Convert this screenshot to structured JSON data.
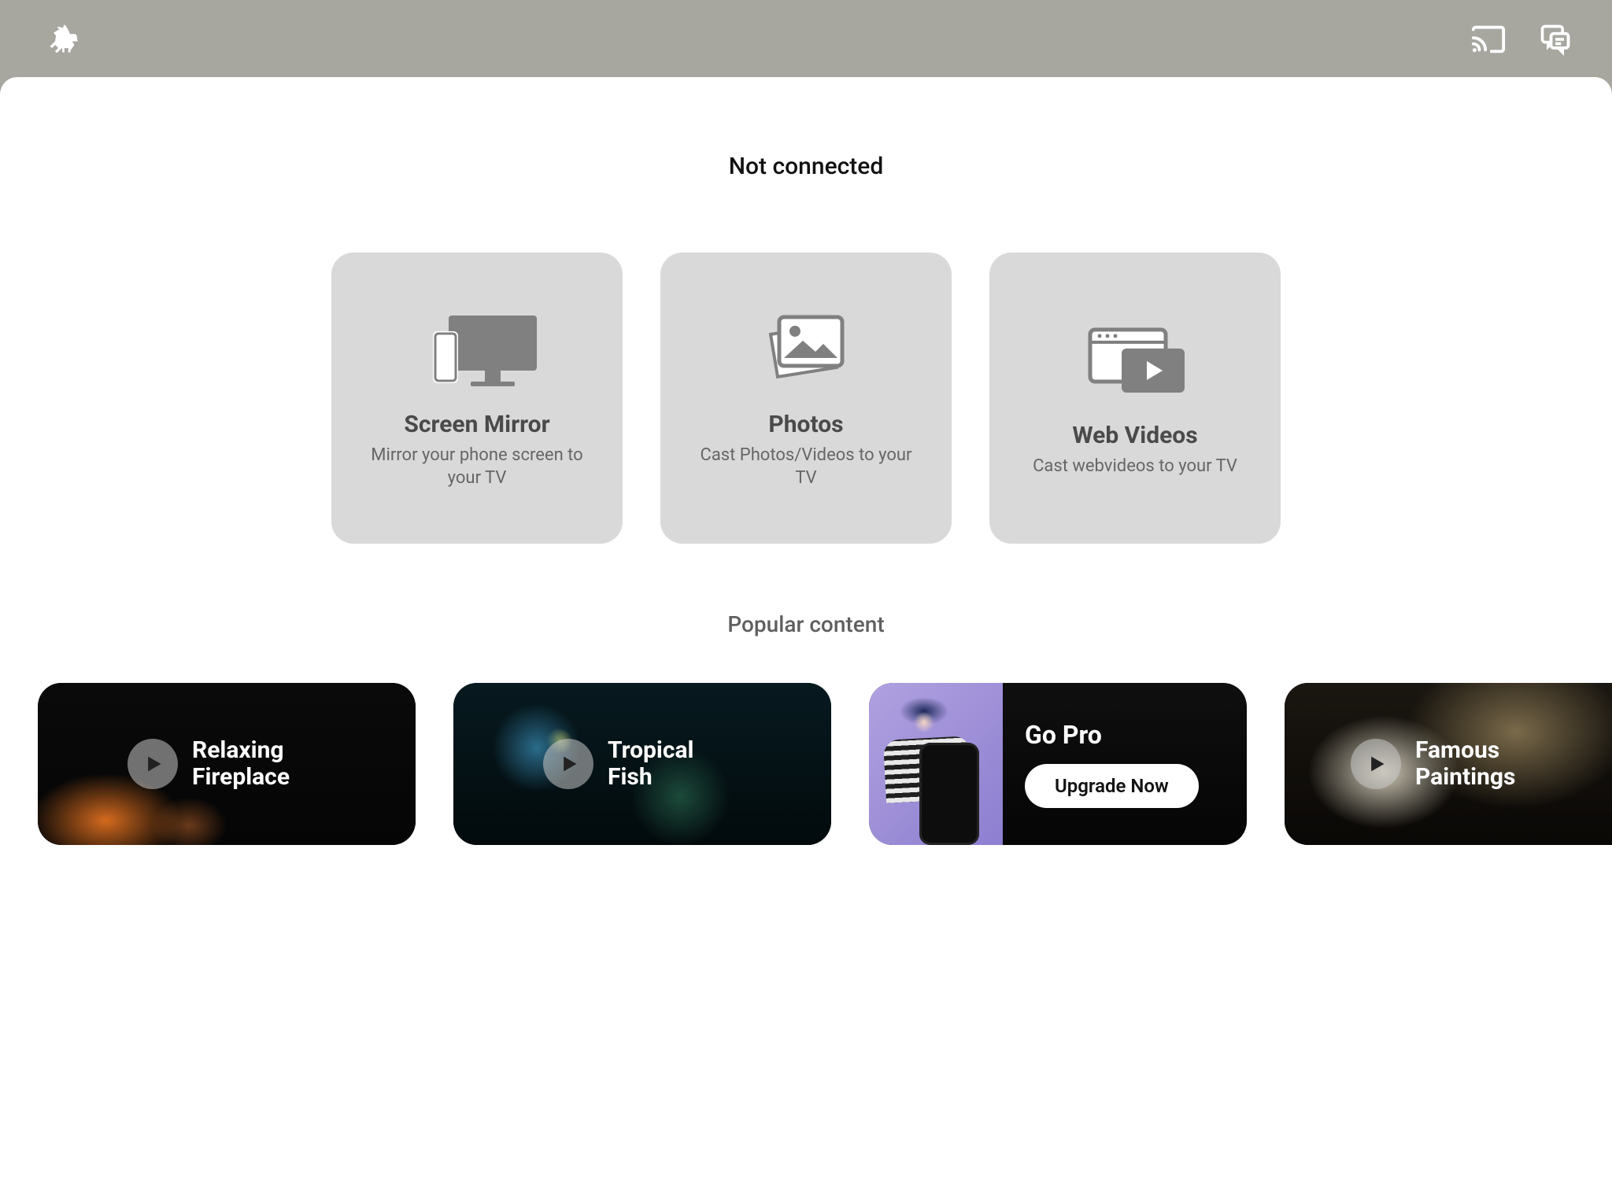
{
  "header": {
    "icons": {
      "rocket": "rocket-icon",
      "cast": "cast-icon",
      "chat": "chat-icon"
    }
  },
  "status": "Not connected",
  "cards": {
    "screen_mirror": {
      "title": "Screen Mirror",
      "desc": "Mirror your phone screen to your TV"
    },
    "photos": {
      "title": "Photos",
      "desc": "Cast Photos/Videos to your TV"
    },
    "web_videos": {
      "title": "Web Videos",
      "desc": "Cast webvideos to your TV"
    }
  },
  "popular": {
    "heading": "Popular content",
    "items": {
      "fireplace": "Relaxing Fireplace",
      "fish": "Tropical Fish",
      "paintings": "Famous Paintings"
    },
    "promo": {
      "title": "Go Pro",
      "cta": "Upgrade Now"
    }
  }
}
